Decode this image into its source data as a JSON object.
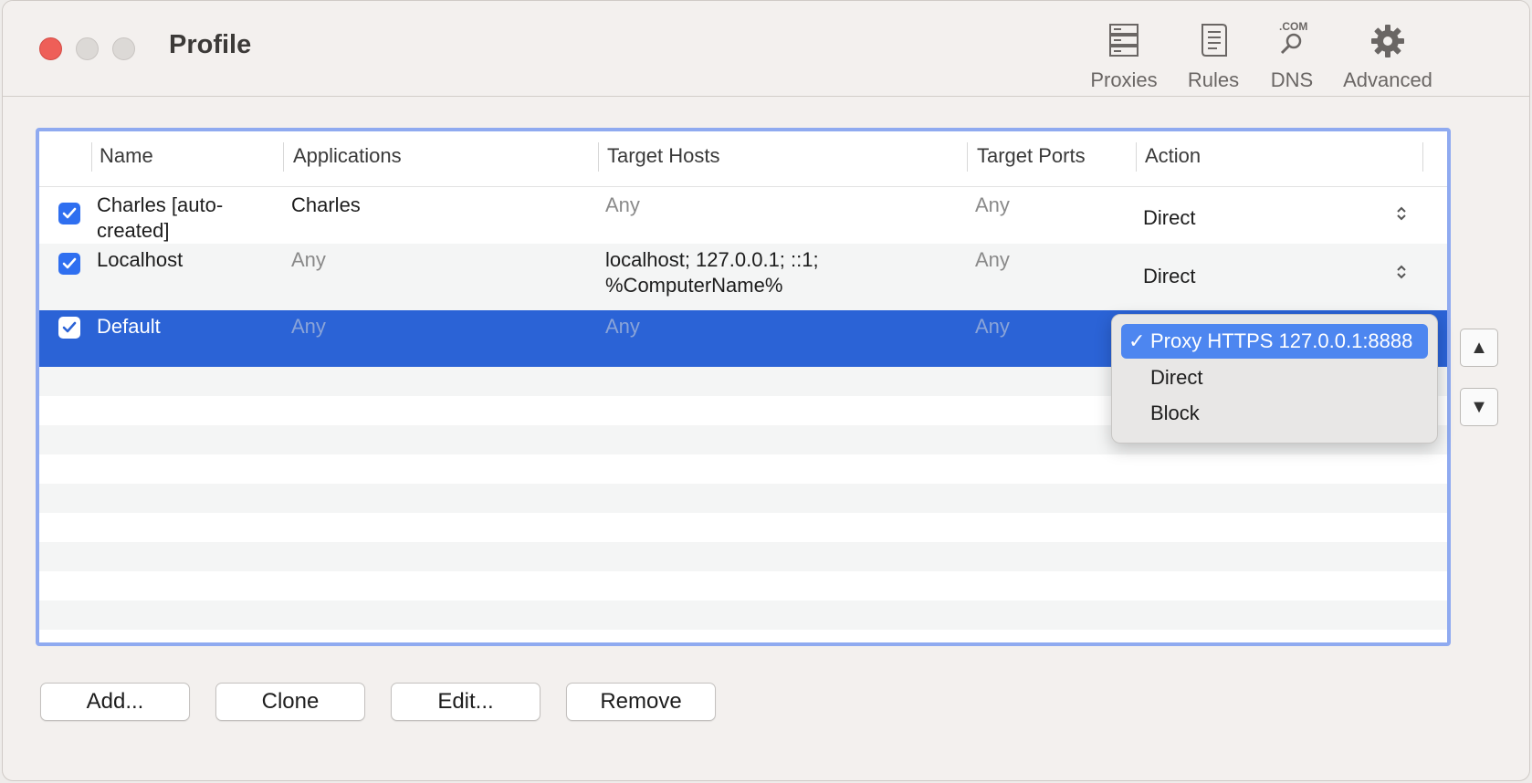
{
  "window": {
    "title": "Profile"
  },
  "toolbar": {
    "items": [
      {
        "label": "Proxies",
        "icon": "server-icon"
      },
      {
        "label": "Rules",
        "icon": "document-icon"
      },
      {
        "label": "DNS",
        "icon": "dns-search-icon",
        "icon_text": ".COM"
      },
      {
        "label": "Advanced",
        "icon": "gear-icon"
      }
    ]
  },
  "table": {
    "columns": [
      "Name",
      "Applications",
      "Target Hosts",
      "Target Ports",
      "Action"
    ],
    "rows": [
      {
        "checked": true,
        "name": "Charles [auto-created]",
        "applications": "Charles",
        "target_hosts": "Any",
        "target_ports": "Any",
        "action": "Direct"
      },
      {
        "checked": true,
        "name": "Localhost",
        "applications": "Any",
        "target_hosts": "localhost; 127.0.0.1; ::1; %ComputerName%",
        "target_ports": "Any",
        "action": "Direct"
      },
      {
        "checked": true,
        "name": "Default",
        "applications": "Any",
        "target_hosts": "Any",
        "target_ports": "Any",
        "action": "Proxy HTTPS 127.0.0.1:8888",
        "selected": true
      }
    ]
  },
  "action_menu": {
    "options": [
      "Proxy HTTPS 127.0.0.1:8888",
      "Direct",
      "Block"
    ],
    "selected": "Proxy HTTPS 127.0.0.1:8888",
    "checkmark": "✓"
  },
  "buttons": {
    "add": "Add...",
    "clone": "Clone",
    "edit": "Edit...",
    "remove": "Remove"
  },
  "reorder": {
    "up": "▲",
    "down": "▼"
  },
  "colors": {
    "selection": "#2b63d6",
    "focus_ring": "#8faaf0",
    "checkbox": "#2f6ff0",
    "menu_highlight": "#4d86f0"
  }
}
